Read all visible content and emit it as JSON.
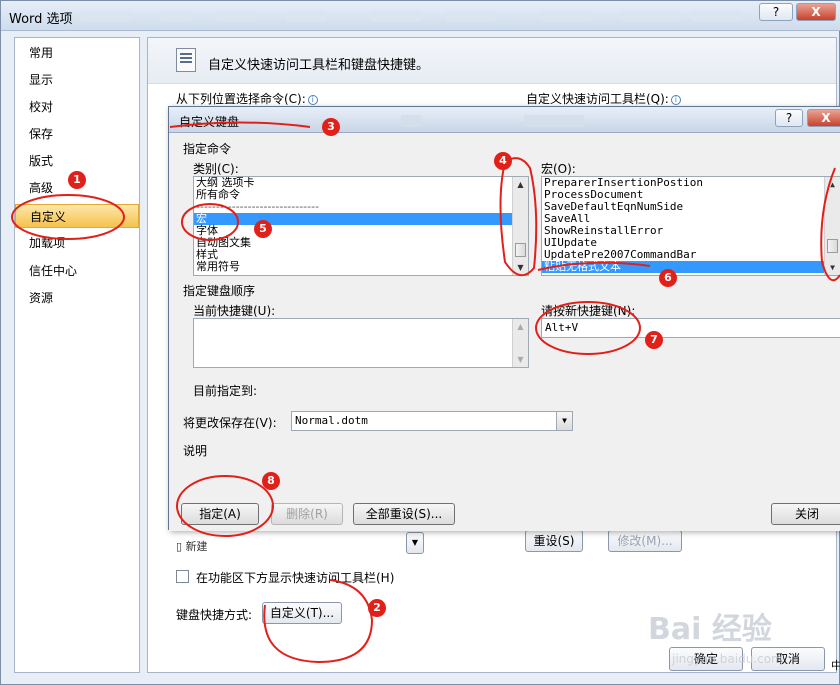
{
  "outer": {
    "title": "Word 选项",
    "help_label": "?",
    "close_label": "X",
    "nav_items": [
      "常用",
      "显示",
      "校对",
      "保存",
      "版式",
      "高级",
      "自定义",
      "加载项",
      "信任中心",
      "资源"
    ],
    "header": "自定义快速访问工具栏和键盘快捷键。",
    "choose_from_label": "从下列位置选择命令(C):",
    "customize_qat_label": "自定义快速访问工具栏(Q):",
    "below_ribbon_label": "在功能区下方显示快速访问工具栏(H)",
    "keyboard_shortcuts_label": "键盘快捷方式:",
    "customize_button": "自定义(T)...",
    "reset_button": "重设(S)",
    "modify_button": "修改(M)...",
    "ok_button": "确定",
    "cancel_button": "取消",
    "peek_item": "新建",
    "corner_label": "中"
  },
  "dialog": {
    "title": "自定义键盘",
    "help_label": "?",
    "close_label": "X",
    "specify_command": "指定命令",
    "categories_label": "类别(C):",
    "categories": [
      "大纲 选项卡",
      "所有命令",
      "-------------------------------",
      "宏",
      "字体",
      "自动图文集",
      "样式",
      "常用符号"
    ],
    "macros_label": "宏(O):",
    "macros": [
      "PreparerInsertionPostion",
      "ProcessDocument",
      "SaveDefaultEqnNumSide",
      "SaveAll",
      "ShowReinstallError",
      "UIUpdate",
      "UpdatePre2007CommandBar",
      "粘贴无格式文本"
    ],
    "key_sequence": "指定键盘顺序",
    "current_keys_label": "当前快捷键(U):",
    "new_key_label": "请按新快捷键(N):",
    "new_key_value": "Alt+V",
    "currently_assigned": "目前指定到:",
    "save_changes_label": "将更改保存在(V):",
    "save_changes_value": "Normal.dotm",
    "description_label": "说明",
    "assign_button": "指定(A)",
    "remove_button": "删除(R)",
    "reset_all_button": "全部重设(S)...",
    "close_button": "关闭"
  },
  "annotations": [
    "1",
    "2",
    "3",
    "4",
    "5",
    "6",
    "7",
    "8"
  ],
  "watermark": {
    "logo": "Bai 经验",
    "url": "jingyan.baidu.com"
  }
}
